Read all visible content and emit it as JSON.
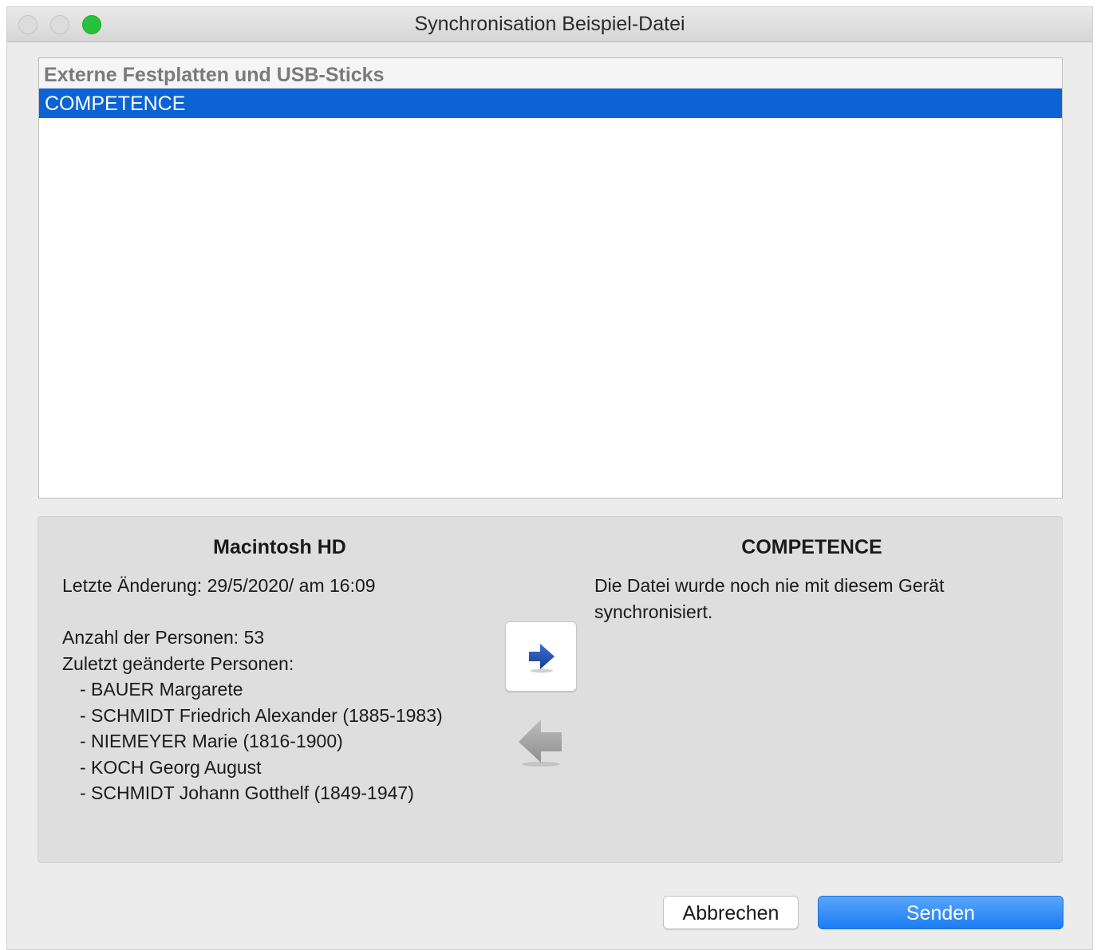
{
  "window": {
    "title": "Synchronisation Beispiel-Datei"
  },
  "device_list": {
    "header": "Externe Festplatten und USB-Sticks",
    "items": [
      {
        "label": "COMPETENCE",
        "selected": true
      }
    ]
  },
  "sync": {
    "left": {
      "title": "Macintosh HD",
      "last_change": "Letzte Änderung: 29/5/2020/ am 16:09",
      "person_count": "Anzahl der Personen: 53",
      "recent_label": "Zuletzt geänderte Personen:",
      "recent_persons": [
        "- BAUER Margarete",
        "- SCHMIDT Friedrich Alexander (1885-1983)",
        "- NIEMEYER Marie (1816-1900)",
        "- KOCH Georg August",
        "- SCHMIDT Johann Gotthelf (1849-1947)"
      ]
    },
    "right": {
      "title": "COMPETENCE",
      "message": "Die Datei wurde noch nie mit diesem Gerät synchronisiert."
    },
    "icons": {
      "forward": "arrow-right-icon",
      "backward": "arrow-left-icon"
    }
  },
  "buttons": {
    "cancel": "Abbrechen",
    "send": "Senden"
  },
  "colors": {
    "selection": "#0b63d4",
    "send_button": "#1a7ef2",
    "arrow_active": "#1f4fb3",
    "arrow_inactive": "#a9a9a9",
    "zoom_light": "#27c23b"
  }
}
